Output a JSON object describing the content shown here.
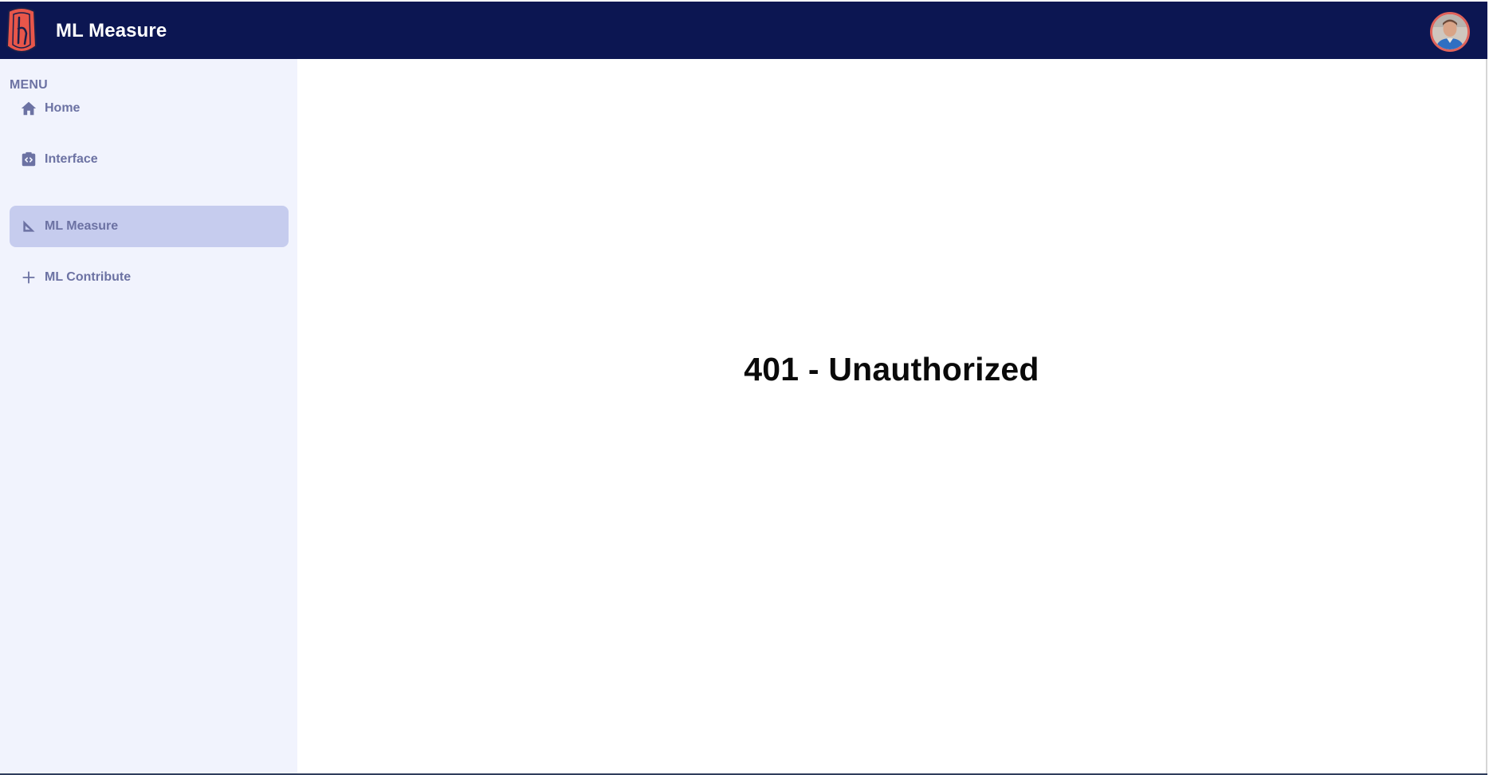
{
  "header": {
    "title": "ML Measure",
    "logo_icon": "university-shield-logo",
    "avatar_icon": "user-avatar",
    "background_color": "#0c1652"
  },
  "sidebar": {
    "menu_label": "MENU",
    "items": [
      {
        "label": "Home",
        "icon": "home-icon",
        "active": false
      },
      {
        "label": "Interface",
        "icon": "code-window-icon",
        "active": false
      },
      {
        "label": "ML Measure",
        "icon": "set-square-icon",
        "active": true
      },
      {
        "label": "ML Contribute",
        "icon": "plus-icon",
        "active": false
      }
    ],
    "background_color": "#f1f3fd",
    "active_color": "#c6ccee",
    "text_color": "#6c72a3"
  },
  "main": {
    "message": "401 - Unauthorized"
  }
}
